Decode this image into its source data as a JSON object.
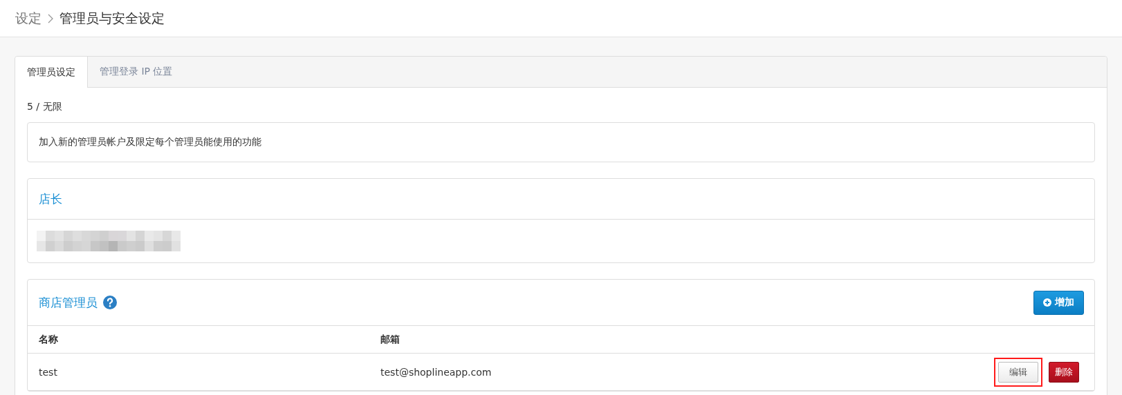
{
  "breadcrumb": {
    "parent": "设定",
    "current": "管理员与安全设定"
  },
  "tabs": [
    {
      "label": "管理员设定",
      "selected": true
    },
    {
      "label": "管理登录 IP 位置",
      "selected": false
    }
  ],
  "usage": "5 / 无限",
  "description": "加入新的管理员帐户及限定每个管理员能使用的功能",
  "owner": {
    "title": "店长"
  },
  "admins": {
    "title": "商店管理员",
    "add_button": "增加",
    "columns": [
      "名称",
      "邮箱"
    ],
    "rows": [
      {
        "name": "test",
        "email": "test@shoplineapp.com",
        "actions": [
          {
            "kind": "edit",
            "label": "编辑",
            "highlighted": true
          },
          {
            "kind": "delete",
            "label": "删除",
            "highlighted": false
          }
        ]
      }
    ]
  }
}
